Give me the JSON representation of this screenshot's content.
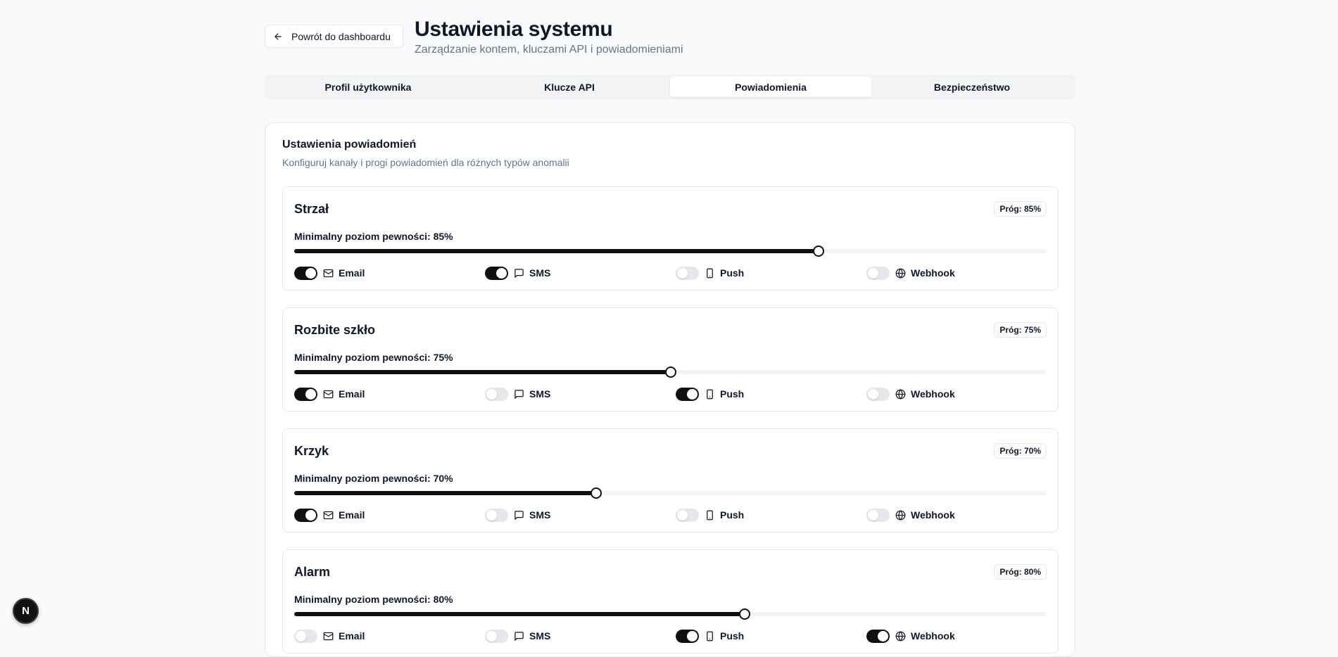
{
  "header": {
    "back_label": "Powrót do dashboardu",
    "title": "Ustawienia systemu",
    "subtitle": "Zarządzanie kontem, kluczami API i powiadomieniami"
  },
  "tabs": [
    {
      "label": "Profil użytkownika",
      "active": false
    },
    {
      "label": "Klucze API",
      "active": false
    },
    {
      "label": "Powiadomienia",
      "active": true
    },
    {
      "label": "Bezpieczeństwo",
      "active": false
    }
  ],
  "card": {
    "title": "Ustawienia powiadomień",
    "description": "Konfiguruj kanały i progi powiadomień dla różnych typów anomalii"
  },
  "channel_labels": {
    "email": "Email",
    "sms": "SMS",
    "push": "Push",
    "webhook": "Webhook"
  },
  "channel_icons": {
    "email": "mail-icon",
    "sms": "message-icon",
    "push": "smartphone-icon",
    "webhook": "globe-icon"
  },
  "notifications": [
    {
      "name": "Strzał",
      "badge": "Próg: 85%",
      "slider_label": "Minimalny poziom pewności: 85%",
      "slider_fraction": 0.697,
      "channels": {
        "email": true,
        "sms": true,
        "push": false,
        "webhook": false
      }
    },
    {
      "name": "Rozbite szkło",
      "badge": "Próg: 75%",
      "slider_label": "Minimalny poziom pewności: 75%",
      "slider_fraction": 0.5,
      "channels": {
        "email": true,
        "sms": false,
        "push": true,
        "webhook": false
      }
    },
    {
      "name": "Krzyk",
      "badge": "Próg: 70%",
      "slider_label": "Minimalny poziom pewności: 70%",
      "slider_fraction": 0.401,
      "channels": {
        "email": true,
        "sms": false,
        "push": false,
        "webhook": false
      }
    },
    {
      "name": "Alarm",
      "badge": "Próg: 80%",
      "slider_label": "Minimalny poziom pewności: 80%",
      "slider_fraction": 0.599,
      "channels": {
        "email": false,
        "sms": false,
        "push": true,
        "webhook": true
      }
    }
  ],
  "dev_badge": "N"
}
